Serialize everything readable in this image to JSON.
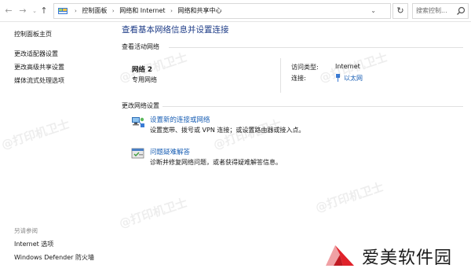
{
  "addressbar": {
    "breadcrumb": [
      "控制面板",
      "网络和 Internet",
      "网络和共享中心"
    ],
    "search_placeholder": "搜索控制..."
  },
  "sidebar": {
    "items": [
      {
        "label": "控制面板主页"
      },
      {
        "label": "更改适配器设置"
      },
      {
        "label": "更改高级共享设置"
      },
      {
        "label": "媒体流式处理选项"
      }
    ],
    "see_also_heading": "另请参阅",
    "see_also": [
      {
        "label": "Internet 选项"
      },
      {
        "label": "Windows Defender 防火墙"
      }
    ]
  },
  "main": {
    "title": "查看基本网络信息并设置连接",
    "active_networks_heading": "查看活动网络",
    "network": {
      "name": "网络 2",
      "type": "专用网络",
      "access_type_label": "访问类型:",
      "access_type_value": "Internet",
      "connections_label": "连接:",
      "connections_value": "以太网"
    },
    "change_settings_heading": "更改网络设置",
    "tasks": [
      {
        "title": "设置新的连接或网络",
        "desc": "设置宽带、拨号或 VPN 连接；或设置路由器或接入点。",
        "icon": "network-setup-icon"
      },
      {
        "title": "问题疑难解答",
        "desc": "诊断并修复网络问题，或者获得疑难解答信息。",
        "icon": "troubleshoot-icon"
      }
    ]
  },
  "watermark": {
    "text": "@打印机卫士",
    "brand": "爱美软件园"
  },
  "colors": {
    "link": "#1a5fb4",
    "title": "#1e3c87",
    "brand_red": "#e0222a"
  }
}
